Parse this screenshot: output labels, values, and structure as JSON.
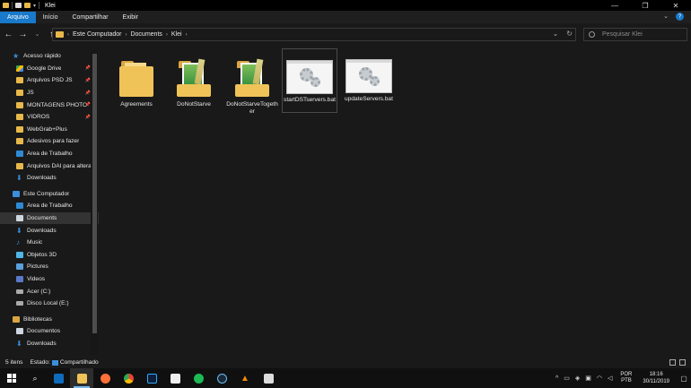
{
  "window": {
    "title": "Klei"
  },
  "ribbon": {
    "tabs": [
      "Arquivo",
      "Início",
      "Compartilhar",
      "Exibir"
    ]
  },
  "address": {
    "crumbs": [
      "Este Computador",
      "Documents",
      "Klei"
    ]
  },
  "search": {
    "placeholder": "Pesquisar Klei"
  },
  "sidebar": {
    "quick_access": "Acesso rápido",
    "quick_items": [
      {
        "label": "Google Drive",
        "icon": "google-drive-icon"
      },
      {
        "label": "Arquivos PSD JS",
        "icon": "folder-icon"
      },
      {
        "label": "JS",
        "icon": "image-folder-icon"
      },
      {
        "label": "MONTAGENS PHOTO",
        "icon": "folder-icon"
      },
      {
        "label": "VIDROS",
        "icon": "folder-icon"
      },
      {
        "label": "WebGrab+Plus",
        "icon": "folder-icon"
      },
      {
        "label": "Adesivos para fazer",
        "icon": "folder-icon"
      },
      {
        "label": "Área de Trabalho",
        "icon": "desktop-icon"
      },
      {
        "label": "Arquivos DAI para alterar",
        "icon": "folder-icon"
      },
      {
        "label": "Downloads",
        "icon": "download-icon"
      }
    ],
    "this_pc": "Este Computador",
    "pc_items": [
      {
        "label": "Área de Trabalho",
        "icon": "desktop-icon"
      },
      {
        "label": "Documents",
        "icon": "document-icon"
      },
      {
        "label": "Downloads",
        "icon": "download-icon"
      },
      {
        "label": "Music",
        "icon": "music-icon"
      },
      {
        "label": "Objetos 3D",
        "icon": "cube-icon"
      },
      {
        "label": "Pictures",
        "icon": "picture-icon"
      },
      {
        "label": "Videos",
        "icon": "video-icon"
      },
      {
        "label": "Acer (C:)",
        "icon": "drive-icon"
      },
      {
        "label": "Disco Local (E:)",
        "icon": "drive-icon"
      }
    ],
    "libraries": "Bibliotecas",
    "lib_items": [
      {
        "label": "Documentos",
        "icon": "document-icon"
      },
      {
        "label": "Downloads",
        "icon": "download-icon"
      }
    ]
  },
  "files": [
    {
      "name": "Agreements",
      "type": "folder"
    },
    {
      "name": "DoNotStarve",
      "type": "folder-art"
    },
    {
      "name": "DoNotStarveTogether",
      "type": "folder-art"
    },
    {
      "name": "startDSTservers.bat",
      "type": "bat"
    },
    {
      "name": "updateServers.bat",
      "type": "bat"
    }
  ],
  "status": {
    "count": "5 itens",
    "state_label": "Estado:",
    "state_value": "Compartilhado"
  },
  "taskbar": {
    "lang": "POR",
    "layout": "PTB",
    "time": "18:16",
    "date": "30/11/2019"
  },
  "colors": {
    "accent": "#1979ca",
    "folder": "#f0c358",
    "background": "#191919"
  }
}
